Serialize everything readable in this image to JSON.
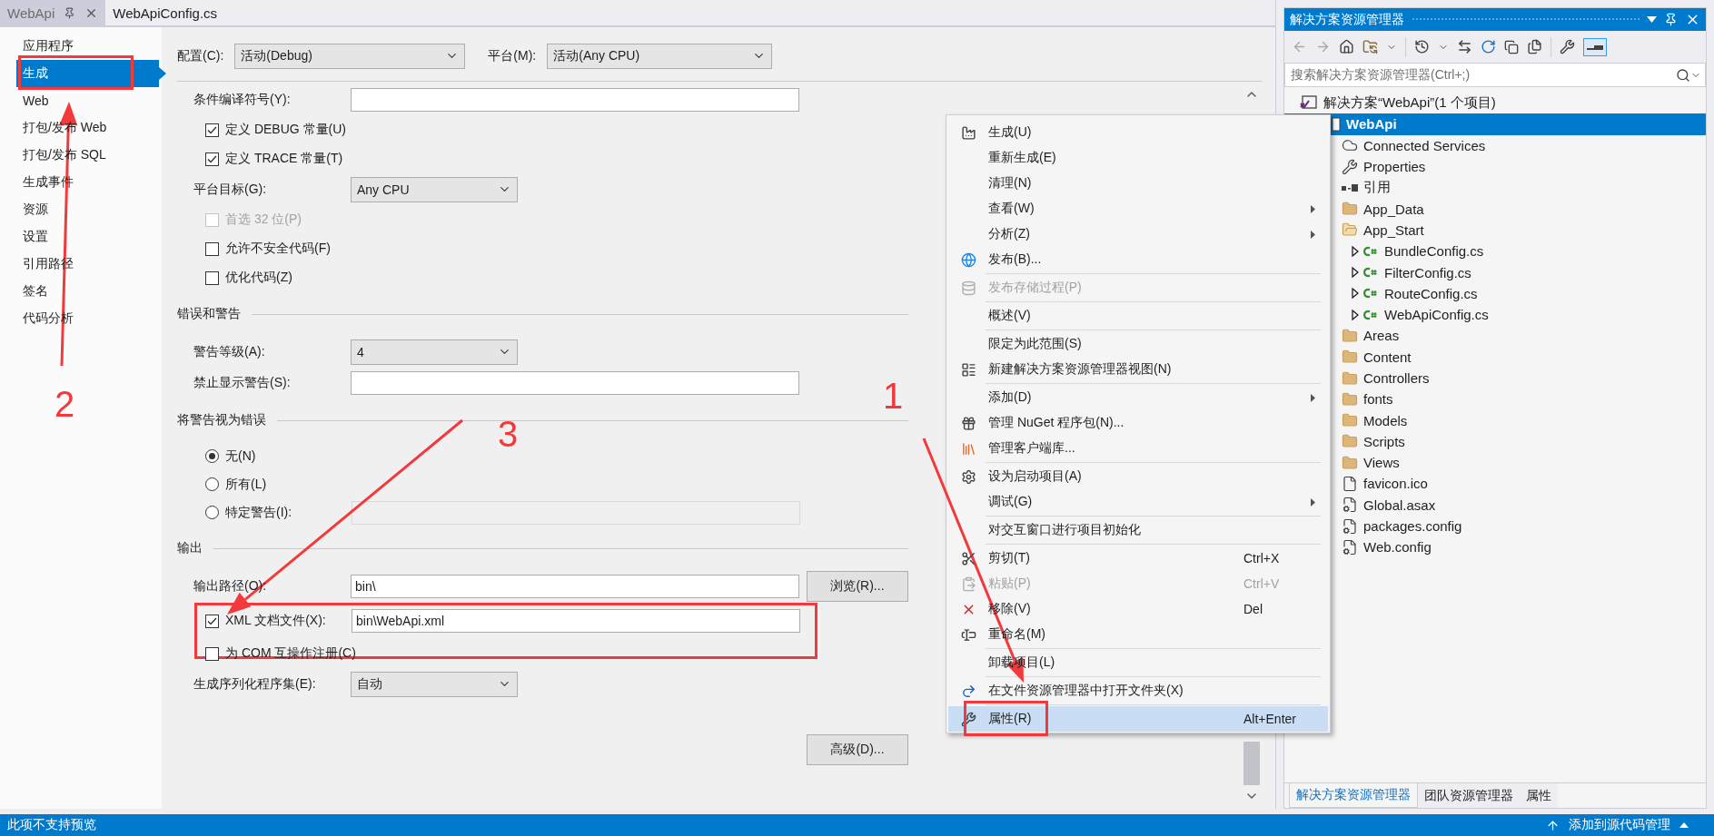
{
  "document_tabs": [
    {
      "label": "WebApi",
      "selected": true
    },
    {
      "label": "WebApiConfig.cs",
      "selected": false
    }
  ],
  "nav": [
    {
      "label": "应用程序",
      "selected": false
    },
    {
      "label": "生成",
      "selected": true
    },
    {
      "label": "Web",
      "selected": false
    },
    {
      "label": "打包/发布 Web",
      "selected": false
    },
    {
      "label": "打包/发布 SQL",
      "selected": false
    },
    {
      "label": "生成事件",
      "selected": false
    },
    {
      "label": "资源",
      "selected": false
    },
    {
      "label": "设置",
      "selected": false
    },
    {
      "label": "引用路径",
      "selected": false
    },
    {
      "label": "签名",
      "selected": false
    },
    {
      "label": "代码分析",
      "selected": false
    }
  ],
  "config_bar": {
    "configuration": {
      "label": "配置(C):",
      "value": "活动(Debug)"
    },
    "platform": {
      "label": "平台(M):",
      "value": "活动(Any CPU)"
    }
  },
  "form": [
    {
      "kind": "field",
      "label": "条件编译符号(Y):"
    },
    {
      "kind": "checkbox",
      "label": "定义 DEBUG 常量(U)",
      "checked": true,
      "disabled": false
    },
    {
      "kind": "checkbox",
      "label": "定义 TRACE 常量(T)",
      "checked": true,
      "disabled": false
    },
    {
      "kind": "select",
      "label": "平台目标(G):",
      "value": "Any CPU"
    },
    {
      "kind": "checkbox",
      "label": "首选 32 位(P)",
      "checked": false,
      "disabled": true
    },
    {
      "kind": "checkbox",
      "label": "允许不安全代码(F)",
      "checked": false,
      "disabled": false
    },
    {
      "kind": "checkbox",
      "label": "优化代码(Z)",
      "checked": false,
      "disabled": false
    },
    {
      "kind": "section",
      "label": "错误和警告"
    },
    {
      "kind": "select",
      "label": "警告等级(A):",
      "value": "4"
    },
    {
      "kind": "field",
      "label": "禁止显示警告(S):"
    },
    {
      "kind": "section",
      "label": "将警告视为错误"
    },
    {
      "kind": "radio",
      "label": "无(N)",
      "selected": true
    },
    {
      "kind": "radio",
      "label": "所有(L)",
      "selected": false
    },
    {
      "kind": "radio",
      "label": "特定警告(I):",
      "selected": false,
      "field": {
        "disabled": true
      }
    },
    {
      "kind": "section",
      "label": "输出"
    },
    {
      "kind": "field",
      "label": "输出路径(O):",
      "value": "bin\\",
      "button": "浏览(R)..."
    },
    {
      "kind": "checkbox",
      "label": "XML 文档文件(X):",
      "checked": true,
      "disabled": false,
      "field": {
        "value": "bin\\WebApi.xml",
        "disabled": false
      }
    },
    {
      "kind": "checkbox",
      "label": "为 COM 互操作注册(C)",
      "checked": false,
      "disabled": false
    },
    {
      "kind": "select",
      "label": "生成序列化程序集(E):",
      "value": "自动"
    },
    {
      "kind": "button",
      "label": "高级(D)..."
    }
  ],
  "context_menu": {
    "groups": [
      [
        {
          "label": "生成(U)",
          "selected": false,
          "disabled": false,
          "submenu": false
        },
        {
          "label": "重新生成(E)",
          "selected": false,
          "disabled": false,
          "submenu": false
        },
        {
          "label": "清理(N)",
          "selected": false,
          "disabled": false,
          "submenu": false
        },
        {
          "label": "查看(W)",
          "selected": false,
          "disabled": false,
          "submenu": true
        },
        {
          "label": "分析(Z)",
          "selected": false,
          "disabled": false,
          "submenu": true
        },
        {
          "label": "发布(B)...",
          "selected": false,
          "disabled": false,
          "submenu": false
        }
      ],
      [
        {
          "label": "发布存储过程(P)",
          "selected": false,
          "disabled": true,
          "submenu": false
        }
      ],
      [
        {
          "label": "概述(V)",
          "selected": false,
          "disabled": false,
          "submenu": false
        }
      ],
      [
        {
          "label": "限定为此范围(S)",
          "selected": false,
          "disabled": false,
          "submenu": false
        },
        {
          "label": "新建解决方案资源管理器视图(N)",
          "selected": false,
          "disabled": false,
          "submenu": false
        }
      ],
      [
        {
          "label": "添加(D)",
          "selected": false,
          "disabled": false,
          "submenu": true
        },
        {
          "label": "管理 NuGet 程序包(N)...",
          "selected": false,
          "disabled": false,
          "submenu": false
        },
        {
          "label": "管理客户端库...",
          "selected": false,
          "disabled": false,
          "submenu": false
        }
      ],
      [
        {
          "label": "设为启动项目(A)",
          "selected": false,
          "disabled": false,
          "submenu": false
        },
        {
          "label": "调试(G)",
          "selected": false,
          "disabled": false,
          "submenu": true
        }
      ],
      [
        {
          "label": "对交互窗口进行项目初始化",
          "selected": false,
          "disabled": false,
          "submenu": false
        }
      ],
      [
        {
          "label": "剪切(T)",
          "shortcut": "Ctrl+X",
          "selected": false,
          "disabled": false,
          "submenu": false
        },
        {
          "label": "粘贴(P)",
          "shortcut": "Ctrl+V",
          "selected": false,
          "disabled": true,
          "submenu": false
        },
        {
          "label": "移除(V)",
          "shortcut": "Del",
          "selected": false,
          "disabled": false,
          "submenu": false
        },
        {
          "label": "重命名(M)",
          "selected": false,
          "disabled": false,
          "submenu": false
        }
      ],
      [
        {
          "label": "卸载项目(L)",
          "selected": false,
          "disabled": false,
          "submenu": false
        }
      ],
      [
        {
          "label": "在文件资源管理器中打开文件夹(X)",
          "selected": false,
          "disabled": false,
          "submenu": false
        }
      ],
      [
        {
          "label": "属性(R)",
          "shortcut": "Alt+Enter",
          "selected": true,
          "disabled": false,
          "submenu": false
        }
      ]
    ]
  },
  "solution_explorer": {
    "title": "解决方案资源管理器",
    "search_placeholder": "搜索解决方案资源管理器(Ctrl+;)",
    "tree": [
      {
        "label": "解决方案“WebApi”(1 个项目)",
        "kind": "solution",
        "selected": false,
        "children": [
          {
            "label": "WebApi",
            "kind": "project",
            "selected": true,
            "children": [
              {
                "label": "Connected Services",
                "kind": "connected",
                "selected": false
              },
              {
                "label": "Properties",
                "kind": "properties",
                "selected": false
              },
              {
                "label": "引用",
                "kind": "references",
                "selected": false
              },
              {
                "label": "App_Data",
                "kind": "folder",
                "selected": false
              },
              {
                "label": "App_Start",
                "kind": "folder-open",
                "selected": false,
                "children": [
                  {
                    "label": "BundleConfig.cs",
                    "kind": "csharp",
                    "selected": false,
                    "expanded": false
                  },
                  {
                    "label": "FilterConfig.cs",
                    "kind": "csharp",
                    "selected": false,
                    "expanded": false
                  },
                  {
                    "label": "RouteConfig.cs",
                    "kind": "csharp",
                    "selected": false,
                    "expanded": false
                  },
                  {
                    "label": "WebApiConfig.cs",
                    "kind": "csharp",
                    "selected": false,
                    "expanded": false
                  }
                ]
              },
              {
                "label": "Areas",
                "kind": "folder",
                "selected": false
              },
              {
                "label": "Content",
                "kind": "folder",
                "selected": false
              },
              {
                "label": "Controllers",
                "kind": "folder",
                "selected": false
              },
              {
                "label": "fonts",
                "kind": "folder",
                "selected": false
              },
              {
                "label": "Models",
                "kind": "folder",
                "selected": false
              },
              {
                "label": "Scripts",
                "kind": "folder",
                "selected": false
              },
              {
                "label": "Views",
                "kind": "folder",
                "selected": false
              },
              {
                "label": "favicon.ico",
                "kind": "image-file",
                "selected": false
              },
              {
                "label": "Global.asax",
                "kind": "global-file",
                "selected": false
              },
              {
                "label": "packages.config",
                "kind": "config",
                "selected": false
              },
              {
                "label": "Web.config",
                "kind": "config",
                "selected": false
              }
            ]
          }
        ]
      }
    ],
    "tabs": [
      {
        "label": "解决方案资源管理器",
        "selected": true
      },
      {
        "label": "团队资源管理器",
        "selected": false
      },
      {
        "label": "属性",
        "selected": false
      }
    ]
  },
  "status_bar": {
    "message": "此项不支持预览",
    "source_control": "添加到源代码管理"
  },
  "annotations": [
    {
      "number": "1"
    },
    {
      "number": "2"
    },
    {
      "number": "3"
    }
  ]
}
